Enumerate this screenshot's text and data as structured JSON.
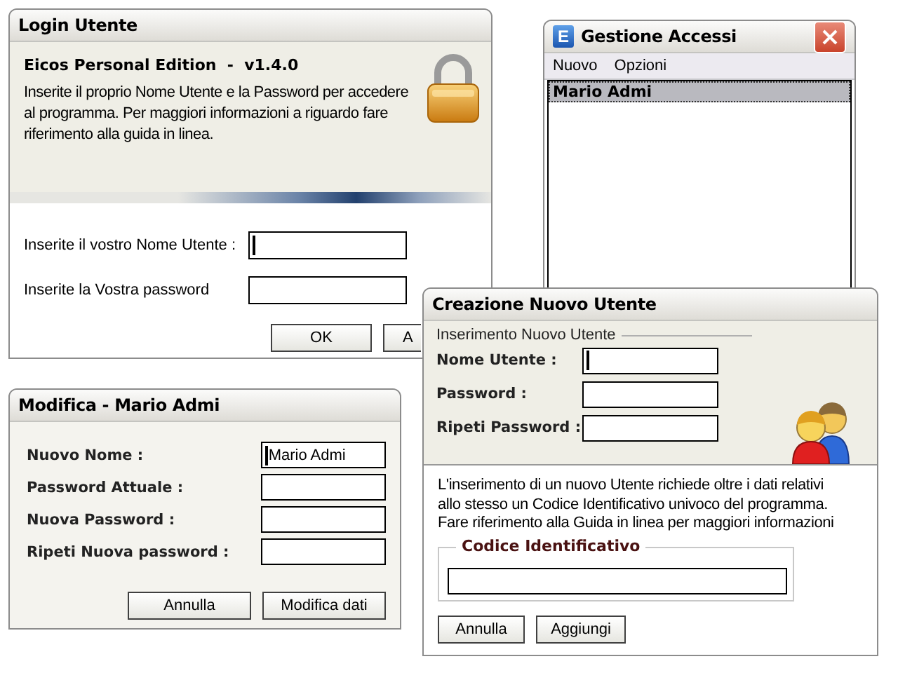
{
  "windows": [
    {
      "kind": "login",
      "title": "Login Utente",
      "heading": "Eicos Personal Edition  -  v1.4.0",
      "description": "Inserite il proprio Nome Utente e la Password per accedere al programma. Per maggiori informazioni a riguardo fare riferimento alla guida in linea.",
      "fields": [
        {
          "label": "Inserite il vostro Nome Utente :",
          "focused": true
        },
        {
          "label": "Inserite la Vostra password",
          "focused": false
        }
      ],
      "buttons": [
        "OK",
        "A"
      ]
    },
    {
      "kind": "list",
      "title": "Gestione Accessi",
      "icon_label": "E",
      "menu": [
        "Nuovo",
        "Opzioni"
      ],
      "items": [
        {
          "label": "Mario Admi",
          "selected": true
        }
      ]
    },
    {
      "kind": "edit",
      "title": "Modifica - Mario Admi",
      "fields": [
        {
          "label": "Nuovo Nome :",
          "value": "Mario Admi",
          "focused": true
        },
        {
          "label": "Password Attuale :",
          "focused": false
        },
        {
          "label": "Nuova Password :",
          "focused": false
        },
        {
          "label": "Ripeti Nuova password :",
          "focused": false
        }
      ],
      "buttons": [
        "Annulla",
        "Modifica dati"
      ]
    },
    {
      "kind": "create",
      "title": "Creazione Nuovo Utente",
      "section": "Inserimento Nuovo Utente",
      "fields": [
        {
          "label": "Nome Utente :",
          "focused": true
        },
        {
          "label": "Password :",
          "focused": false
        },
        {
          "label": "Ripeti Password :",
          "focused": false
        }
      ],
      "note": "L'inserimento di un nuovo Utente richiede oltre i dati relativi allo stesso un Codice Identificativo univoco del programma. Fare riferimento alla Guida in linea per maggiori informazioni",
      "group": {
        "title": "Codice Identificativo"
      },
      "buttons": [
        "Annulla",
        "Aggiungi"
      ]
    }
  ]
}
